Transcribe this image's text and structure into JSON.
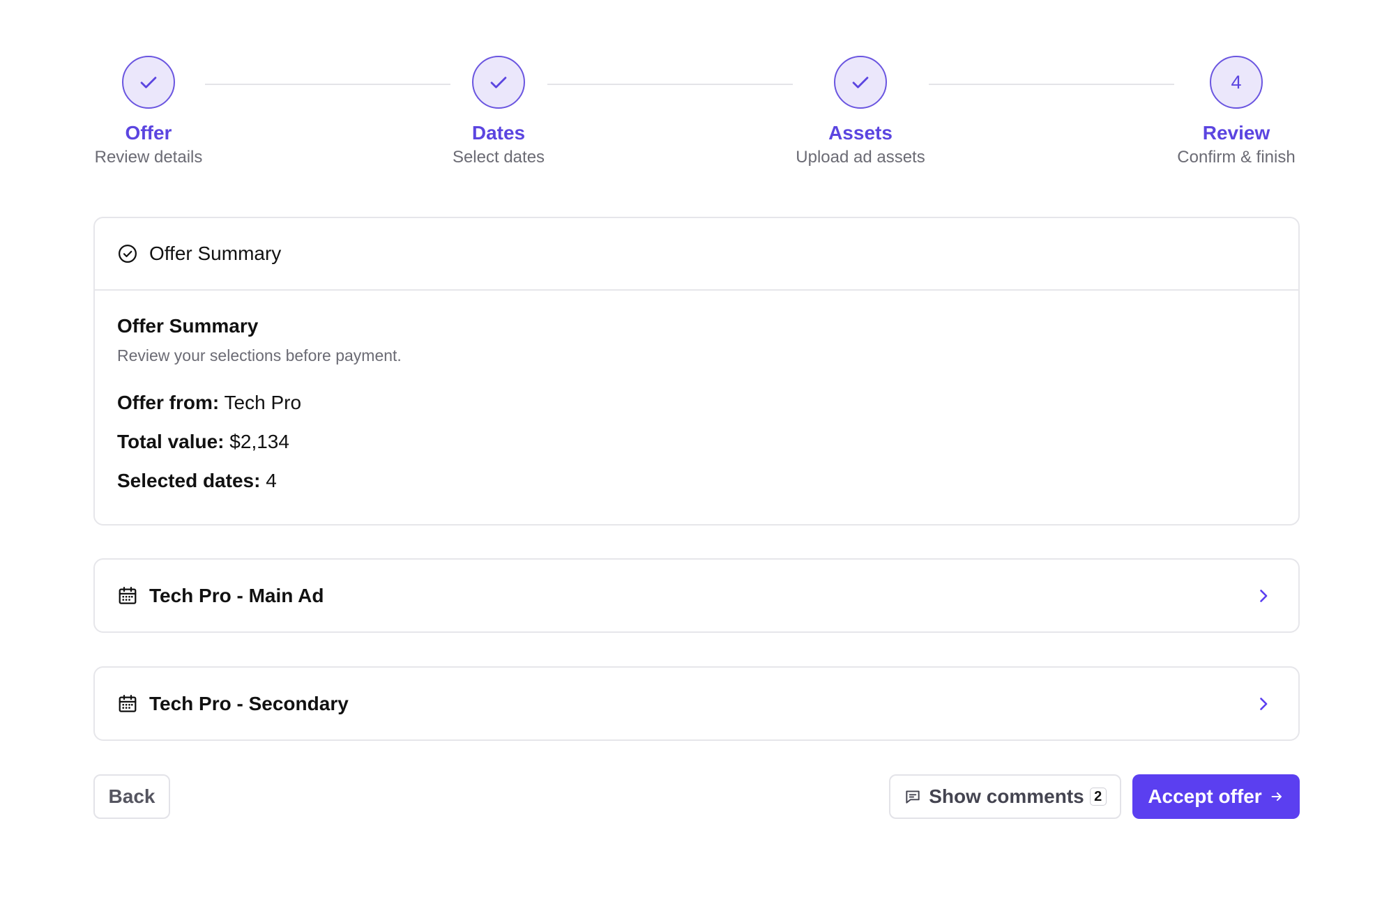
{
  "stepper": {
    "steps": [
      {
        "title": "Offer",
        "subtitle": "Review details",
        "state": "complete"
      },
      {
        "title": "Dates",
        "subtitle": "Select dates",
        "state": "complete"
      },
      {
        "title": "Assets",
        "subtitle": "Upload ad assets",
        "state": "complete"
      },
      {
        "title": "Review",
        "subtitle": "Confirm & finish",
        "state": "current",
        "number": "4"
      }
    ]
  },
  "summary": {
    "header_label": "Offer Summary",
    "header_icon": "check-circle-icon",
    "title": "Offer Summary",
    "description": "Review your selections before payment.",
    "details": [
      {
        "label": "Offer from:",
        "value": "Tech Pro"
      },
      {
        "label": "Total value:",
        "value": "$2,134"
      },
      {
        "label": "Selected dates:",
        "value": "4"
      }
    ]
  },
  "ads": [
    {
      "title": "Tech Pro - Main Ad",
      "icon": "calendar-icon"
    },
    {
      "title": "Tech Pro - Secondary",
      "icon": "calendar-icon"
    }
  ],
  "footer": {
    "back_label": "Back",
    "comments_label": "Show comments",
    "comments_count": "2",
    "accept_label": "Accept offer"
  },
  "colors": {
    "accent": "#5b3ff0",
    "step_border": "#6a55e0",
    "step_fill": "#ebe7fb",
    "border": "#e6e6ea",
    "muted_text": "#6b6b74"
  }
}
